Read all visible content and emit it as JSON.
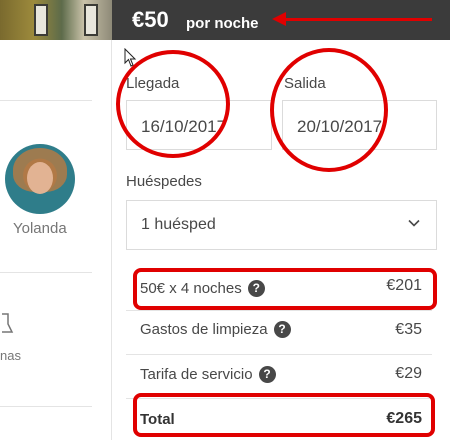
{
  "header": {
    "price": "€50",
    "price_suffix": "por noche"
  },
  "host": {
    "name": "Yolanda"
  },
  "left_panel": {
    "amenity_text": "nas"
  },
  "booking": {
    "checkin_label": "Llegada",
    "checkin_value": "16/10/2017",
    "checkout_label": "Salida",
    "checkout_value": "20/10/2017",
    "guests_label": "Huéspedes",
    "guests_value": "1 huésped"
  },
  "fees": [
    {
      "label": "50€ x 4 noches",
      "value": "€201"
    },
    {
      "label": "Gastos de limpieza",
      "value": "€35"
    },
    {
      "label": "Tarifa de servicio",
      "value": "€29"
    }
  ],
  "total": {
    "label": "Total",
    "value": "€265"
  },
  "colors": {
    "banner": "#3b3b3b",
    "annotation": "#e00000",
    "text": "#484848",
    "border": "#dbdbdb"
  }
}
